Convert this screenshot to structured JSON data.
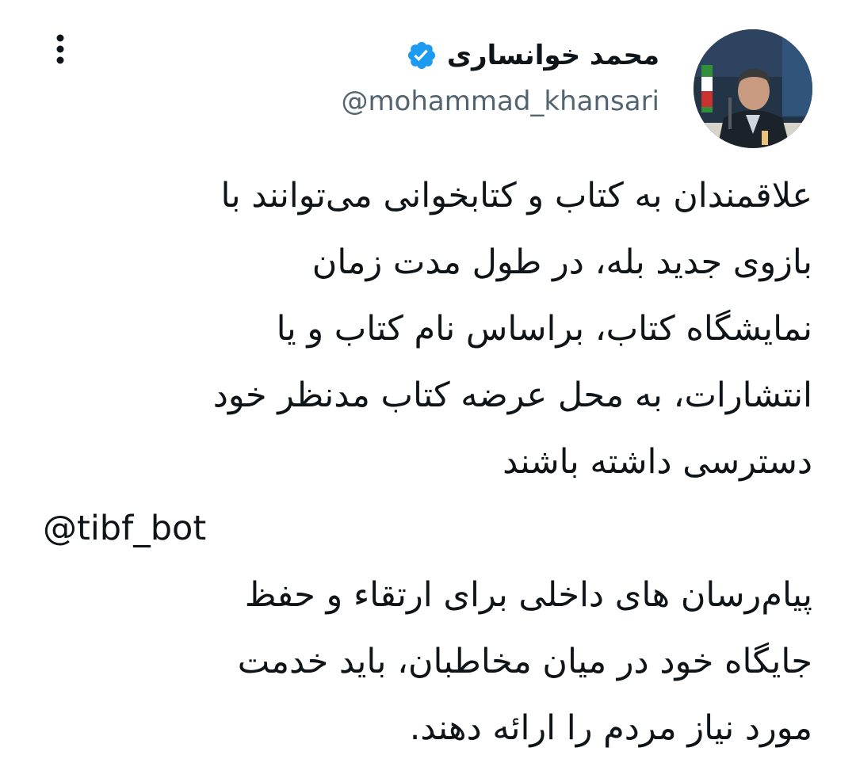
{
  "author": {
    "display_name": "محمد خوانساری",
    "handle": "@mohammad_khansari",
    "verified": true,
    "verified_color": "#1d9bf0"
  },
  "tweet": {
    "paragraph_1": "علاقمندان به کتاب و کتابخوانی می‌توانند با\nبازوی جدید بله، در طول مدت زمان\nنمایشگاه کتاب، براساس نام کتاب و یا\nانتشارات، به محل عرضه کتاب مدنظر خود\nدسترسی داشته باشند",
    "mention": "@tibf_bot",
    "paragraph_2": "پیام‌رسان های داخلی برای ارتقاء و حفظ\nجایگاه خود در میان مخاطبان، باید خدمت\nمورد نیاز مردم را ارائه دهند."
  },
  "icons": {
    "more": "more-vertical-icon",
    "verified": "verified-badge-icon"
  },
  "colors": {
    "text": "#0f1419",
    "secondary_text": "#536471",
    "background": "#ffffff"
  }
}
